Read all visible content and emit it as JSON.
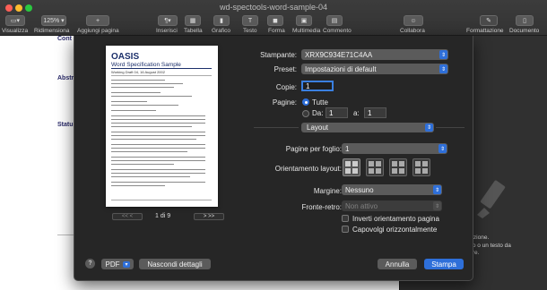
{
  "window": {
    "title": "wd-spectools-word-sample-04"
  },
  "toolbar": {
    "zoom": "125%",
    "items": [
      {
        "label": "Visualizza"
      },
      {
        "label": "Ridimensiona"
      },
      {
        "label": "Aggiungi pagina"
      },
      {
        "label": "Inserisci"
      },
      {
        "label": "Tabella"
      },
      {
        "label": "Grafico"
      },
      {
        "label": "Testo"
      },
      {
        "label": "Forma"
      },
      {
        "label": "Multimedia"
      },
      {
        "label": "Commento"
      },
      {
        "label": "Collabora"
      },
      {
        "label": "Formattazione"
      },
      {
        "label": "Documento"
      }
    ]
  },
  "document": {
    "headings": [
      "Cont",
      "Abstr",
      "Statu"
    ]
  },
  "sidebar": {
    "note": "selezione.\ngetto o un testo da\nattare."
  },
  "preview": {
    "logo": "OASIS",
    "title": "Word Specification Sample",
    "subtitle": "Working Draft 04, 16 August 2002",
    "page_label": "1 di 9",
    "prev_label": "<<  <",
    "next_label": ">  >>"
  },
  "print": {
    "printer_label": "Stampante:",
    "printer_value": "XRX9C934E71C4AA",
    "preset_label": "Preset:",
    "preset_value": "Impostazioni di default",
    "copies_label": "Copie:",
    "copies_value": "1",
    "pages_label": "Pagine:",
    "pages_all": "Tutte",
    "pages_from": "Da:",
    "from_value": "1",
    "to_label": "a:",
    "to_value": "1",
    "section": "Layout",
    "pages_per_sheet_label": "Pagine per foglio:",
    "pages_per_sheet_value": "1",
    "orientation_label": "Orientamento layout:",
    "margin_label": "Margine:",
    "margin_value": "Nessuno",
    "duplex_label": "Fronte-retro:",
    "duplex_value": "Non attivo",
    "reverse_label": "Inverti orientamento pagina",
    "flip_label": "Capovolgi orizzontalmente",
    "help": "?",
    "pdf": "PDF",
    "hide_details": "Nascondi dettagli",
    "cancel": "Annulla",
    "print": "Stampa"
  },
  "colors": {
    "accent": "#2e6fd9",
    "dialog_bg": "#262626"
  }
}
